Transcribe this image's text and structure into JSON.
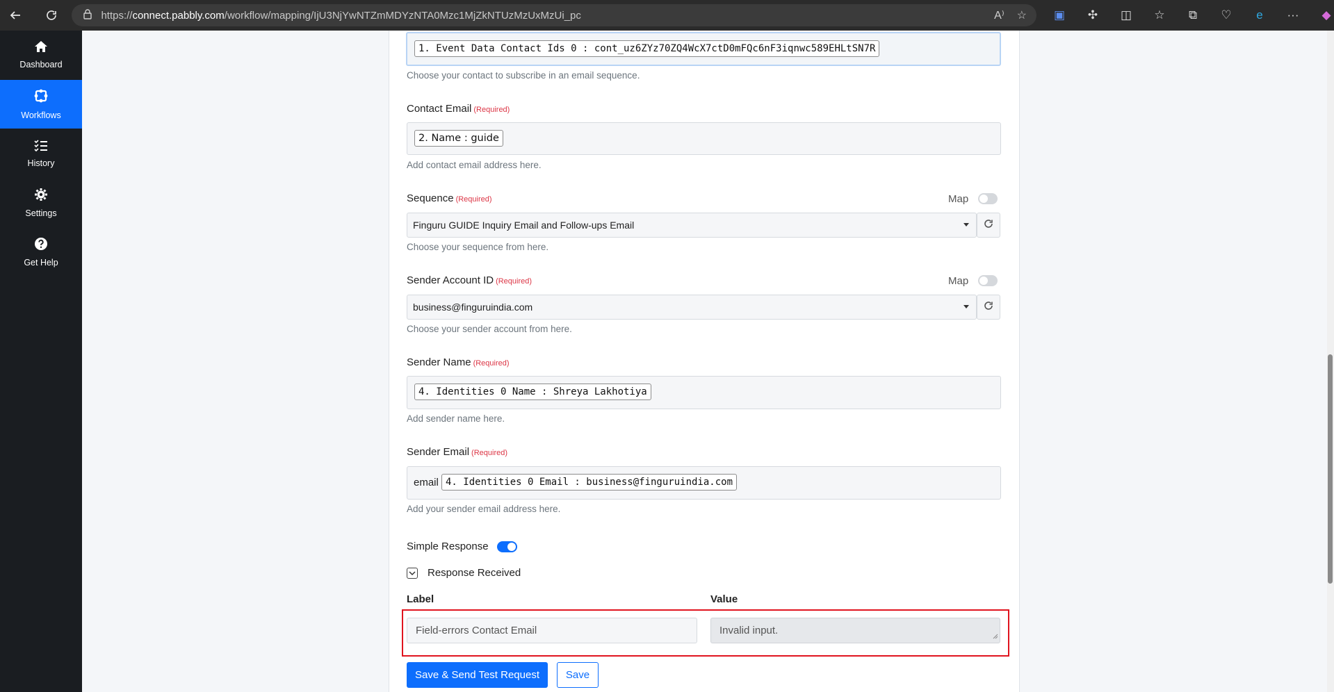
{
  "browser": {
    "url_prefix": "https://",
    "url_host": "connect.pabbly.com",
    "url_path": "/workflow/mapping/IjU3NjYwNTZmMDYzNTA0Mzc1MjZkNTUzMzUxMzUi_pc",
    "read_aloud_label": "A⁾"
  },
  "sidebar": {
    "items": [
      {
        "label": "Dashboard",
        "icon": "home-icon"
      },
      {
        "label": "Workflows",
        "icon": "workflow-icon"
      },
      {
        "label": "History",
        "icon": "history-icon"
      },
      {
        "label": "Settings",
        "icon": "gear-icon"
      },
      {
        "label": "Get Help",
        "icon": "help-icon"
      }
    ]
  },
  "form": {
    "contact_id": {
      "chip": "1. Event Data Contact Ids 0 : cont_uz6ZYz70ZQ4WcX7ctD0mFQc6nF3iqnwc589EHLtSN7R",
      "help": "Choose your contact to subscribe in an email sequence."
    },
    "contact_email": {
      "label": "Contact Email",
      "required": "(Required)",
      "chip": "2. Name : guide",
      "help": "Add contact email address here."
    },
    "sequence": {
      "label": "Sequence",
      "required": "(Required)",
      "map_label": "Map",
      "value": "Finguru GUIDE Inquiry Email and Follow-ups Email",
      "help": "Choose your sequence from here."
    },
    "sender_account": {
      "label": "Sender Account ID",
      "required": "(Required)",
      "map_label": "Map",
      "value": "business@finguruindia.com",
      "help": "Choose your sender account from here."
    },
    "sender_name": {
      "label": "Sender Name",
      "required": "(Required)",
      "chip": "4. Identities 0 Name : Shreya Lakhotiya",
      "help": "Add sender name here."
    },
    "sender_email": {
      "label": "Sender Email",
      "required": "(Required)",
      "prefix": "email",
      "chip": "4. Identities 0 Email : business@finguruindia.com",
      "help": "Add your sender email address here."
    },
    "simple_response": {
      "label": "Simple Response",
      "enabled": true
    },
    "response_received": {
      "label": "Response Received",
      "expanded": true
    }
  },
  "response_table": {
    "label_header": "Label",
    "value_header": "Value",
    "rows": [
      {
        "label": "Field-errors Contact Email",
        "value": "Invalid input."
      }
    ]
  },
  "actions": {
    "save_send_label": "Save & Send Test Request",
    "save_label": "Save"
  },
  "colors": {
    "primary": "#0d6efd",
    "sidebar_bg": "#1a1d21",
    "required": "#dc3545",
    "highlight": "#e0141e"
  }
}
